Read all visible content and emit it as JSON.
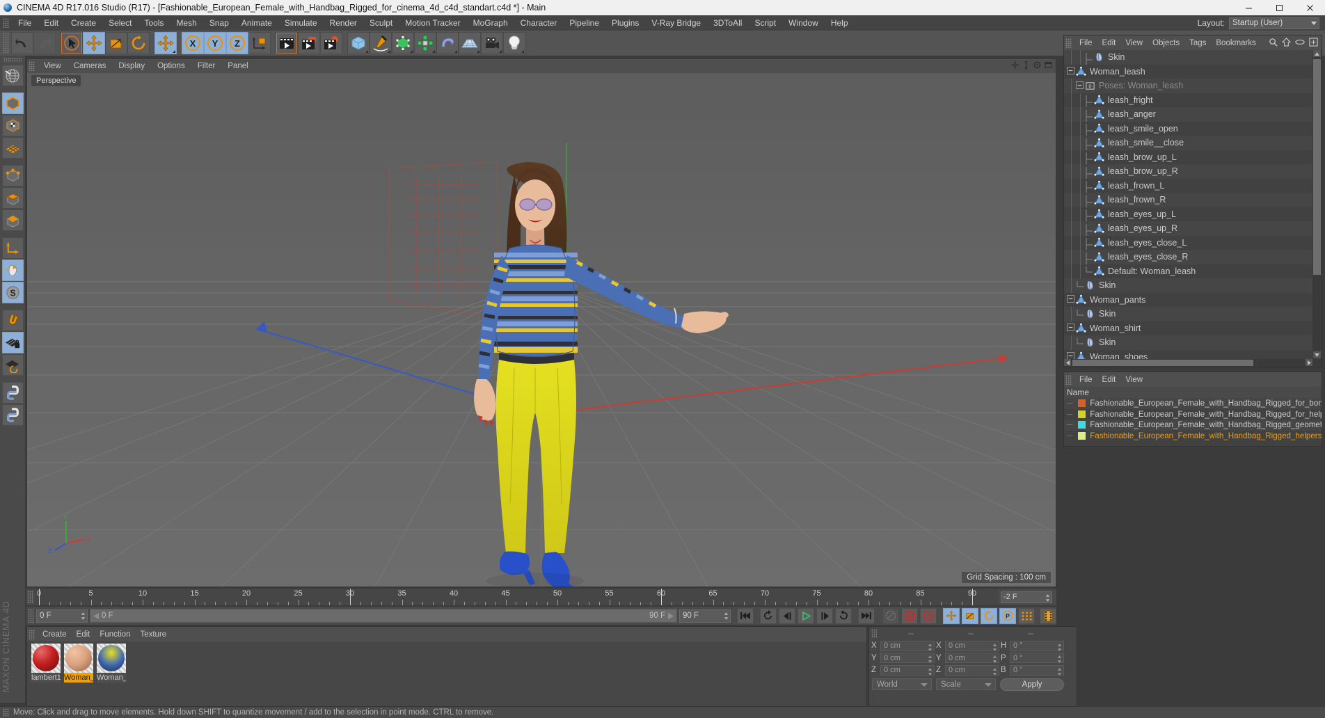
{
  "window": {
    "title": "CINEMA 4D R17.016 Studio (R17) - [Fashionable_European_Female_with_Handbag_Rigged_for_cinema_4d_c4d_standart.c4d *] - Main",
    "app_icon": "c4d-sphere-icon",
    "minimize": "minimize-icon",
    "maximize": "maximize-icon",
    "close": "close-icon"
  },
  "menubar": {
    "items": [
      "File",
      "Edit",
      "Create",
      "Select",
      "Tools",
      "Mesh",
      "Snap",
      "Animate",
      "Simulate",
      "Render",
      "Sculpt",
      "Motion Tracker",
      "MoGraph",
      "Character",
      "Pipeline",
      "Plugins",
      "V-Ray Bridge",
      "3DToAll",
      "Script",
      "Window",
      "Help"
    ],
    "layout_label": "Layout:",
    "layout_value": "Startup (User)"
  },
  "toolbar": {
    "groups": [
      {
        "name": "history",
        "buttons": [
          {
            "name": "undo-icon",
            "state": "normal"
          },
          {
            "name": "redo-icon",
            "state": "disabled"
          }
        ]
      },
      {
        "name": "transform",
        "buttons": [
          {
            "name": "select-live-icon",
            "state": "selected"
          },
          {
            "name": "move-icon",
            "state": "active"
          },
          {
            "name": "scale-icon",
            "state": "normal"
          },
          {
            "name": "rotate-icon",
            "state": "normal"
          }
        ]
      },
      {
        "name": "move-alt",
        "buttons": [
          {
            "name": "move-alt-icon",
            "state": "normal"
          }
        ]
      },
      {
        "name": "axis-lock",
        "buttons": [
          {
            "name": "x-axis-icon",
            "state": "active"
          },
          {
            "name": "y-axis-icon",
            "state": "active"
          },
          {
            "name": "z-axis-icon",
            "state": "active"
          },
          {
            "name": "world-object-axis-icon",
            "state": "normal"
          }
        ]
      },
      {
        "name": "render",
        "buttons": [
          {
            "name": "render-view-icon",
            "state": "selected"
          },
          {
            "name": "render-to-picture-viewer-icon",
            "state": "normal"
          },
          {
            "name": "render-settings-icon",
            "state": "normal"
          }
        ]
      },
      {
        "name": "create",
        "buttons": [
          {
            "name": "cube-primitive-icon",
            "state": "normal"
          },
          {
            "name": "spline-pen-icon",
            "state": "normal"
          },
          {
            "name": "nurbs-generator-icon",
            "state": "normal"
          },
          {
            "name": "array-modeling-icon",
            "state": "normal"
          },
          {
            "name": "deformer-bend-icon",
            "state": "normal"
          },
          {
            "name": "scene-floor-icon",
            "state": "normal"
          },
          {
            "name": "camera-icon",
            "state": "normal"
          },
          {
            "name": "light-icon",
            "state": "normal"
          }
        ]
      }
    ]
  },
  "left_tools": {
    "buttons": [
      {
        "name": "viewport-navigation-icon",
        "state": "normal"
      },
      {
        "name": "model-mode-icon",
        "state": "active"
      },
      {
        "name": "texture-mode-icon",
        "state": "normal"
      },
      {
        "name": "workplane-mode-icon",
        "state": "normal"
      },
      {
        "name": "points-mode-icon",
        "state": "normal"
      },
      {
        "name": "edges-mode-icon",
        "state": "normal"
      },
      {
        "name": "polygons-mode-icon",
        "state": "normal"
      },
      {
        "name": "object-axis-icon",
        "state": "normal"
      },
      {
        "name": "viewport-solo-icon",
        "state": "active"
      },
      {
        "name": "enable-snapping-icon",
        "state": "active"
      },
      {
        "name": "magnet-tool-icon",
        "state": "normal"
      },
      {
        "name": "workplane-lock-icon",
        "state": "active"
      },
      {
        "name": "workplane-rotate-icon",
        "state": "normal"
      },
      {
        "name": "python-script-icon",
        "state": "normal"
      },
      {
        "name": "python-generator-icon",
        "state": "normal"
      }
    ],
    "brand": "MAXON CINEMA 4D"
  },
  "viewport": {
    "menu": [
      "View",
      "Cameras",
      "Display",
      "Options",
      "Filter",
      "Panel"
    ],
    "view_label": "Perspective",
    "grid_spacing": "Grid Spacing : 100 cm",
    "axis_labels": {
      "x": "X",
      "y": "Y",
      "z": "Z"
    },
    "corner_icons": [
      "viewport-move-icon",
      "viewport-scale-icon",
      "viewport-rotate-icon",
      "viewport-maximize-icon"
    ]
  },
  "object_manager": {
    "menu": [
      "File",
      "Edit",
      "View",
      "Objects",
      "Tags",
      "Bookmarks"
    ],
    "right_icons": [
      "search-icon",
      "home-icon",
      "eye-icon",
      "new-icon"
    ],
    "rows": [
      {
        "label": "Skin",
        "icon": "skin-deformer-icon",
        "indent": 3,
        "twirl": "none",
        "dim": false
      },
      {
        "label": "Woman_leash",
        "icon": "polygon-object-icon",
        "indent": 1,
        "twirl": "minus",
        "dim": false
      },
      {
        "label": "Poses: Woman_leash",
        "icon": "pose-morph-tag-icon",
        "indent": 2,
        "twirl": "minus",
        "dim": true
      },
      {
        "label": "leash_fright",
        "icon": "polygon-object-icon",
        "indent": 3,
        "twirl": "none",
        "dim": false
      },
      {
        "label": "leash_anger",
        "icon": "polygon-object-icon",
        "indent": 3,
        "twirl": "none",
        "dim": false
      },
      {
        "label": "leash_smile_open",
        "icon": "polygon-object-icon",
        "indent": 3,
        "twirl": "none",
        "dim": false
      },
      {
        "label": "leash_smile__close",
        "icon": "polygon-object-icon",
        "indent": 3,
        "twirl": "none",
        "dim": false
      },
      {
        "label": "leash_brow_up_L",
        "icon": "polygon-object-icon",
        "indent": 3,
        "twirl": "none",
        "dim": false
      },
      {
        "label": "leash_brow_up_R",
        "icon": "polygon-object-icon",
        "indent": 3,
        "twirl": "none",
        "dim": false
      },
      {
        "label": "leash_frown_L",
        "icon": "polygon-object-icon",
        "indent": 3,
        "twirl": "none",
        "dim": false
      },
      {
        "label": "leash_frown_R",
        "icon": "polygon-object-icon",
        "indent": 3,
        "twirl": "none",
        "dim": false
      },
      {
        "label": "leash_eyes_up_L",
        "icon": "polygon-object-icon",
        "indent": 3,
        "twirl": "none",
        "dim": false
      },
      {
        "label": "leash_eyes_up_R",
        "icon": "polygon-object-icon",
        "indent": 3,
        "twirl": "none",
        "dim": false
      },
      {
        "label": "leash_eyes_close_L",
        "icon": "polygon-object-icon",
        "indent": 3,
        "twirl": "none",
        "dim": false
      },
      {
        "label": "leash_eyes_close_R",
        "icon": "polygon-object-icon",
        "indent": 3,
        "twirl": "none",
        "dim": false
      },
      {
        "label": "Default: Woman_leash",
        "icon": "polygon-object-icon",
        "indent": 3,
        "twirl": "last",
        "dim": false
      },
      {
        "label": "Skin",
        "icon": "skin-deformer-icon",
        "indent": 2,
        "twirl": "last",
        "dim": false
      },
      {
        "label": "Woman_pants",
        "icon": "polygon-object-icon",
        "indent": 1,
        "twirl": "minus",
        "dim": false
      },
      {
        "label": "Skin",
        "icon": "skin-deformer-icon",
        "indent": 2,
        "twirl": "last",
        "dim": false
      },
      {
        "label": "Woman_shirt",
        "icon": "polygon-object-icon",
        "indent": 1,
        "twirl": "minus",
        "dim": false
      },
      {
        "label": "Skin",
        "icon": "skin-deformer-icon",
        "indent": 2,
        "twirl": "last",
        "dim": false
      },
      {
        "label": "Woman_shoes",
        "icon": "polygon-object-icon",
        "indent": 1,
        "twirl": "minus",
        "dim": false
      }
    ]
  },
  "layer_manager": {
    "menu": [
      "File",
      "Edit",
      "View"
    ],
    "column_header": "Name",
    "rows": [
      {
        "label": "Fashionable_European_Female_with_Handbag_Rigged_for_bon",
        "color": "#d4602a",
        "selected": false
      },
      {
        "label": "Fashionable_European_Female_with_Handbag_Rigged_for_help",
        "color": "#d4d424",
        "selected": false
      },
      {
        "label": "Fashionable_European_Female_with_Handbag_Rigged_geometr",
        "color": "#3fdbe0",
        "selected": false
      },
      {
        "label": "Fashionable_European_Female_with_Handbag_Rigged_helpers",
        "color": "#d8f07a",
        "selected": true
      }
    ],
    "selected_color": "#e8a020"
  },
  "timeline": {
    "ticks": [
      0,
      5,
      10,
      15,
      20,
      25,
      30,
      35,
      40,
      45,
      50,
      55,
      60,
      65,
      70,
      75,
      80,
      85,
      90
    ],
    "min_frame": 0,
    "max_frame": 90,
    "playhead_frame": 0,
    "end_offset_field": "-2 F"
  },
  "transport": {
    "current_frame_field": "0 F",
    "slider_left_label": "0 F",
    "slider_right_label": "90 F",
    "end_frame_field": "90 F",
    "buttons": [
      {
        "name": "go-to-start-icon",
        "state": "normal"
      },
      {
        "name": "play-backwards-loop-icon",
        "state": "normal"
      },
      {
        "name": "previous-frame-icon",
        "state": "normal"
      },
      {
        "name": "play-forward-icon",
        "state": "normal"
      },
      {
        "name": "next-frame-icon",
        "state": "normal"
      },
      {
        "name": "play-loop-icon",
        "state": "normal"
      },
      {
        "name": "go-to-end-icon",
        "state": "normal"
      },
      {
        "name": "autokeying-icon",
        "state": "disabled"
      },
      {
        "name": "record-active-objects-icon",
        "state": "normal"
      },
      {
        "name": "keyframe-selection-icon",
        "state": "normal"
      },
      {
        "name": "position-key-icon",
        "state": "active"
      },
      {
        "name": "scale-key-icon",
        "state": "active"
      },
      {
        "name": "rotation-key-icon",
        "state": "active"
      },
      {
        "name": "parameter-key-icon",
        "state": "active"
      },
      {
        "name": "point-level-animation-icon",
        "state": "normal"
      },
      {
        "name": "timeline-window-icon",
        "state": "normal"
      }
    ]
  },
  "material_manager": {
    "menu": [
      "Create",
      "Edit",
      "Function",
      "Texture"
    ],
    "materials": [
      {
        "name": "lambert1",
        "selected": false,
        "swatch_kind": "red-sphere"
      },
      {
        "name": "Woman_",
        "selected": true,
        "swatch_kind": "skin-sphere"
      },
      {
        "name": "Woman_",
        "selected": false,
        "swatch_kind": "clothes-sphere"
      }
    ]
  },
  "coordinates": {
    "headers": [
      "--",
      "--",
      "--"
    ],
    "position": {
      "label_x": "X",
      "label_y": "Y",
      "label_z": "Z",
      "x": "0 cm",
      "y": "0 cm",
      "z": "0 cm"
    },
    "size": {
      "label_x": "X",
      "label_y": "Y",
      "label_z": "Z",
      "x": "0 cm",
      "y": "0 cm",
      "z": "0 cm"
    },
    "rotation": {
      "label_h": "H",
      "label_p": "P",
      "label_b": "B",
      "h": "0 °",
      "p": "0 °",
      "b": "0 °"
    },
    "coord_system": "World",
    "size_mode": "Scale",
    "apply_label": "Apply"
  },
  "status_bar": {
    "text": "Move: Click and drag to move elements. Hold down SHIFT to quantize movement / add to the selection in point mode. CTRL to remove."
  },
  "colors": {
    "accent_orange": "#e8920c",
    "panel_bg": "#414141",
    "toolbar_bg": "#545454",
    "viewport_bg": "#636363",
    "highlight_blue": "#8fb0d6",
    "axis_x": "#c0392b",
    "axis_z": "#2f5bd0",
    "axis_y": "#3fa63f"
  }
}
